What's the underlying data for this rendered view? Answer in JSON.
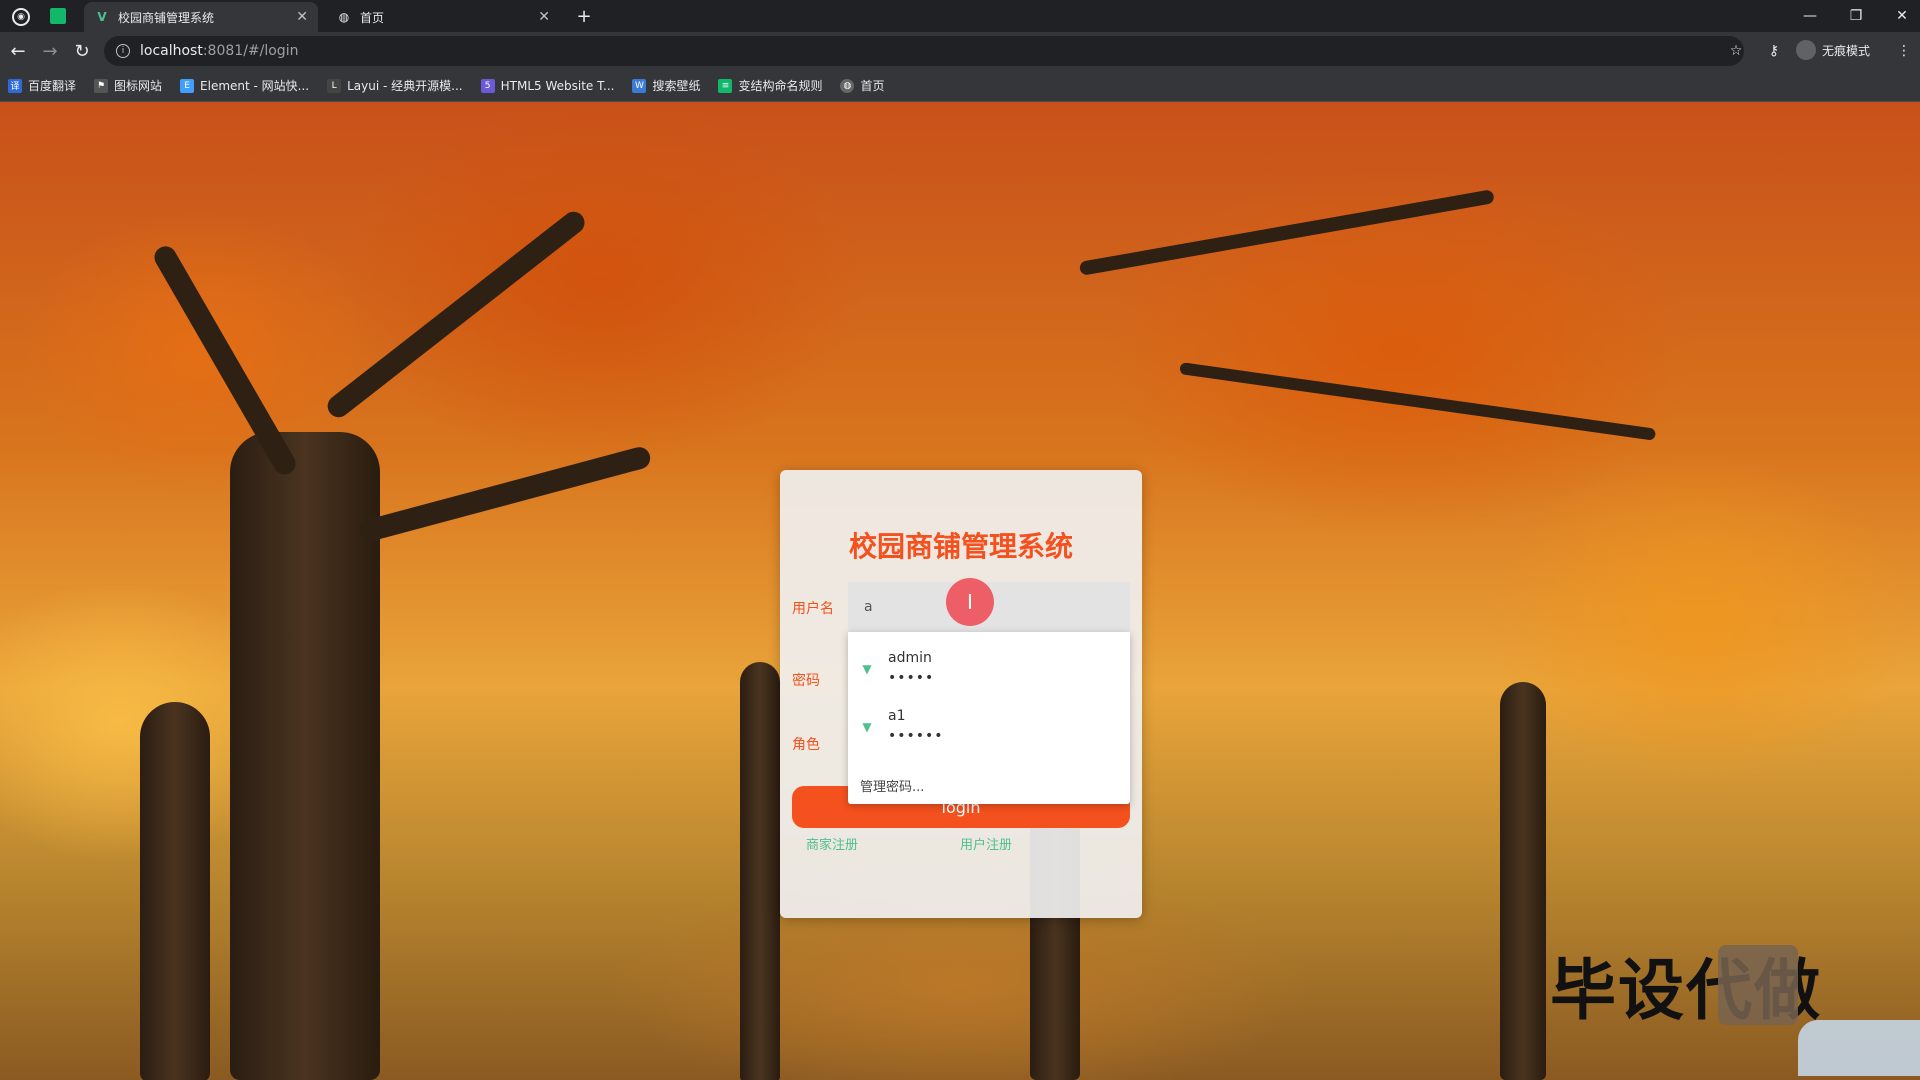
{
  "browser": {
    "tabs": [
      {
        "title": "校园商铺管理系统",
        "active": true
      },
      {
        "title": "首页",
        "active": false
      }
    ],
    "new_tab": "+",
    "url_host": "localhost",
    "url_path": ":8081/#/login",
    "incognito_label": "无痕模式",
    "bookmarks": [
      {
        "label": "百度翻译",
        "color": "#2f6bd8"
      },
      {
        "label": "图标网站",
        "color": "#555555"
      },
      {
        "label": "Element - 网站快...",
        "color": "#409eff"
      },
      {
        "label": "Layui - 经典开源模...",
        "color": "#444444"
      },
      {
        "label": "HTML5 Website T...",
        "color": "#6b5bd6"
      },
      {
        "label": "搜索壁纸",
        "color": "#3a7bd5"
      },
      {
        "label": "变结构命名规则",
        "color": "#12b76a"
      },
      {
        "label": "首页",
        "color": "#666666"
      }
    ]
  },
  "login": {
    "title": "校园商铺管理系统",
    "username_label": "用户名",
    "username_value": "a",
    "password_label": "密码",
    "role_label": "角色",
    "button_label": "login",
    "links": [
      "商家注册",
      "用户注册"
    ]
  },
  "autofill": {
    "items": [
      {
        "username": "admin",
        "password": "•••••"
      },
      {
        "username": "a1",
        "password": "••••••"
      }
    ],
    "manage_label": "管理密码..."
  },
  "overlay": {
    "cursor_glyph": "I",
    "watermark_text": "毕设代做"
  },
  "colors": {
    "accent": "#f4511e",
    "link": "#4fc08d"
  }
}
